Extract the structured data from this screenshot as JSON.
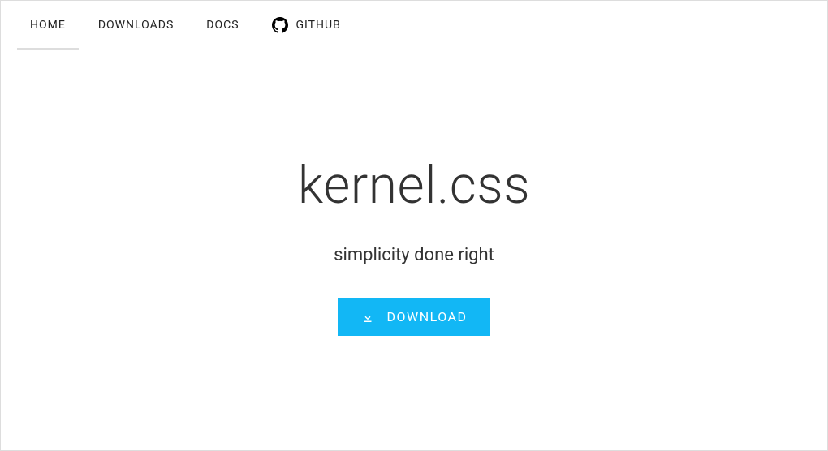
{
  "nav": {
    "items": [
      {
        "label": "HOME",
        "active": true
      },
      {
        "label": "DOWNLOADS",
        "active": false
      },
      {
        "label": "DOCS",
        "active": false
      },
      {
        "label": "GITHUB",
        "active": false,
        "icon": "github-icon"
      }
    ]
  },
  "hero": {
    "title": "kernel.css",
    "subtitle": "simplicity done right",
    "download_label": "DOWNLOAD"
  },
  "colors": {
    "accent": "#12b7f5"
  }
}
